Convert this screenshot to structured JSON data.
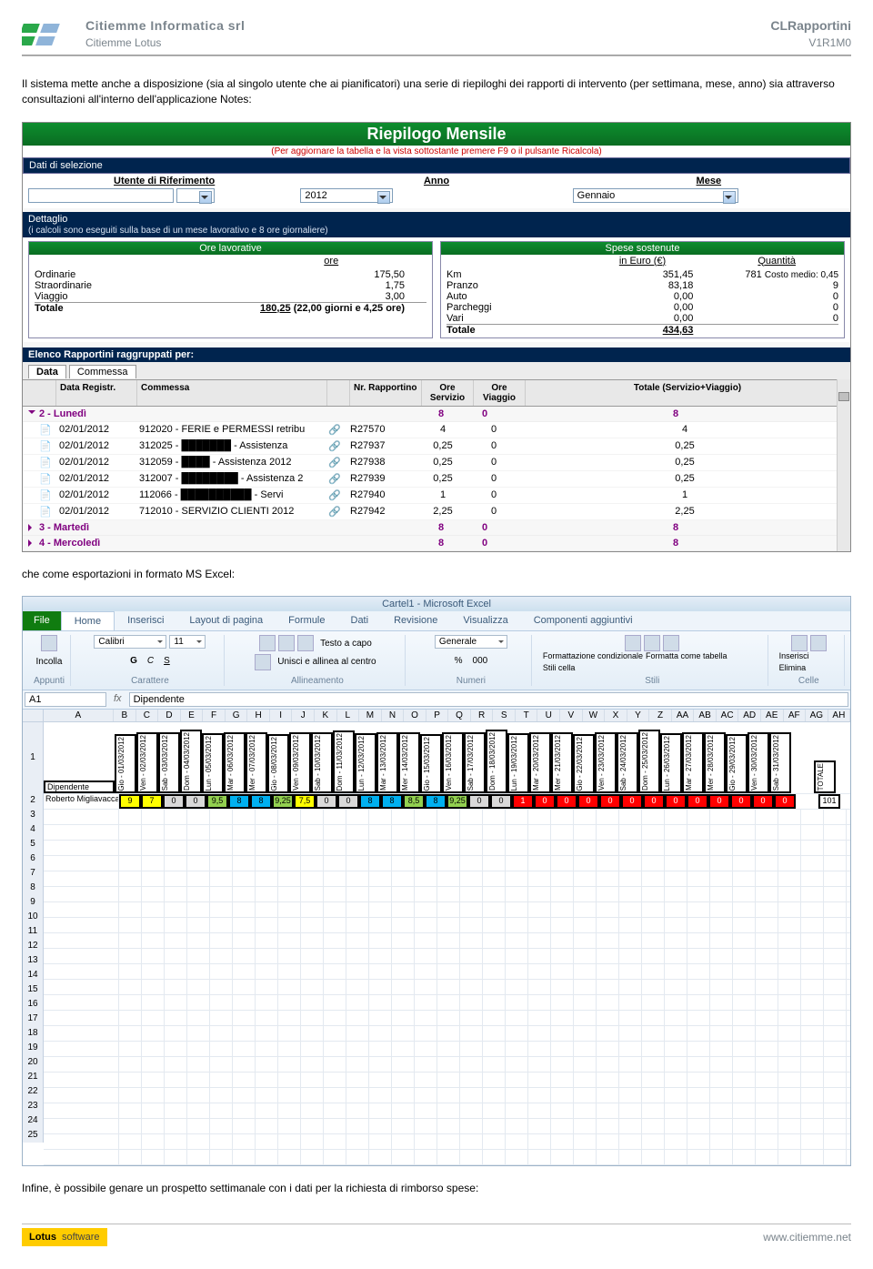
{
  "header": {
    "company": "Citiemme Informatica srl",
    "sub": "Citiemme Lotus",
    "product": "CLRapportini",
    "version": "V1R1M0"
  },
  "para1": "Il sistema mette anche a disposizione (sia al singolo utente che ai pianificatori) una serie di riepiloghi dei rapporti di intervento (per settimana, mese, anno) sia attraverso consultazioni all'interno dell'applicazione Notes:",
  "lotus": {
    "title": "Riepilogo Mensile",
    "hint": "(Per aggiornare la tabella e la vista sottostante premere F9 o il pulsante Ricalcola)",
    "sel": {
      "head": "Dati di selezione",
      "user_lbl": "Utente di Riferimento",
      "user_val": "",
      "anno_lbl": "Anno",
      "anno_val": "2012",
      "mese_lbl": "Mese",
      "mese_val": "Gennaio"
    },
    "det": {
      "head": "Dettaglio",
      "note": "(i calcoli sono eseguiti sulla base di un mese lavorativo e 8 ore giornaliere)"
    },
    "ore": {
      "head": "Ore lavorative",
      "col": "ore",
      "rows": [
        [
          "Ordinarie",
          "175,50"
        ],
        [
          "Straordinarie",
          "1,75"
        ],
        [
          "Viaggio",
          "3,00"
        ]
      ],
      "tot_lbl": "Totale",
      "tot_val": "180,25",
      "note": "(22,00 giorni e 4,25 ore)"
    },
    "spese": {
      "head": "Spese sostenute",
      "col1": "in Euro (€)",
      "col2": "Quantità",
      "rows": [
        [
          "Km",
          "351,45",
          "781"
        ],
        [
          "Pranzo",
          "83,18",
          "9"
        ],
        [
          "Auto",
          "0,00",
          "0"
        ],
        [
          "Parcheggi",
          "0,00",
          "0"
        ],
        [
          "Vari",
          "0,00",
          "0"
        ]
      ],
      "tot_lbl": "Totale",
      "tot_val": "434,63",
      "costo": "Costo medio: 0,45"
    },
    "elHead": "Elenco Rapportini raggruppati per:",
    "tabs": [
      "Data",
      "Commessa"
    ],
    "gcols": [
      "",
      "Data Registr.",
      "Commessa",
      "",
      "Nr. Rapportino",
      "Ore Servizio",
      "Ore Viaggio",
      "Totale (Servizio+Viaggio)"
    ],
    "days": [
      {
        "label": "2 - Lunedì",
        "sum": [
          "8",
          "0",
          "8"
        ],
        "open": true,
        "rows": [
          [
            "02/01/2012",
            "912020 - FERIE e PERMESSI retribu",
            "R27570",
            "4",
            "0",
            "4"
          ],
          [
            "02/01/2012",
            "312025 - ███████ - Assistenza",
            "R27937",
            "0,25",
            "0",
            "0,25"
          ],
          [
            "02/01/2012",
            "312059 - ████ - Assistenza 2012",
            "R27938",
            "0,25",
            "0",
            "0,25"
          ],
          [
            "02/01/2012",
            "312007 - ████████ - Assistenza 2",
            "R27939",
            "0,25",
            "0",
            "0,25"
          ],
          [
            "02/01/2012",
            "112066 - ██████████ - Servi",
            "R27940",
            "1",
            "0",
            "1"
          ],
          [
            "02/01/2012",
            "712010 - SERVIZIO CLIENTI 2012",
            "R27942",
            "2,25",
            "0",
            "2,25"
          ]
        ]
      },
      {
        "label": "3 - Martedì",
        "sum": [
          "8",
          "0",
          "8"
        ],
        "open": false
      },
      {
        "label": "4 - Mercoledì",
        "sum": [
          "8",
          "0",
          "8"
        ],
        "open": false
      }
    ]
  },
  "para2": "che come esportazioni in formato MS Excel:",
  "excel": {
    "winTitle": "Cartel1 - Microsoft Excel",
    "fileTab": "File",
    "tabs": [
      "Home",
      "Inserisci",
      "Layout di pagina",
      "Formule",
      "Dati",
      "Revisione",
      "Visualizza",
      "Componenti aggiuntivi"
    ],
    "groups": {
      "appunti": "Appunti",
      "carattere": "Carattere",
      "allinea": "Allineamento",
      "numeri": "Numeri",
      "stili": "Stili",
      "celle": "Celle"
    },
    "clip": "Incolla",
    "font": "Calibri",
    "size": "11",
    "wrap": "Testo a capo",
    "merge": "Unisci e allinea al centro",
    "numFmt": "Generale",
    "condFmt": "Formattazione condizionale",
    "asTable": "Formatta come tabella",
    "cellStyle": "Stili cella",
    "ins": "Inserisci",
    "del": "Elimina",
    "nameBox": "A1",
    "fxLabel": "fx",
    "fxVal": "Dipendente",
    "colLetters": [
      "A",
      "B",
      "C",
      "D",
      "E",
      "F",
      "G",
      "H",
      "I",
      "J",
      "K",
      "L",
      "M",
      "N",
      "O",
      "P",
      "Q",
      "R",
      "S",
      "T",
      "U",
      "V",
      "W",
      "X",
      "Y",
      "Z",
      "AA",
      "AB",
      "AC",
      "AD",
      "AE",
      "AF",
      "AG",
      "AH"
    ],
    "dateHeaders": [
      "Gio - 01/03/2012",
      "Ven - 02/03/2012",
      "Sab - 03/03/2012",
      "Dom - 04/03/2012",
      "Lun - 05/03/2012",
      "Mar - 06/03/2012",
      "Mer - 07/03/2012",
      "Gio - 08/03/2012",
      "Ven - 09/03/2012",
      "Sab - 10/03/2012",
      "Dom - 11/03/2012",
      "Lun - 12/03/2012",
      "Mar - 13/03/2012",
      "Mer - 14/03/2012",
      "Gio - 15/03/2012",
      "Ven - 16/03/2012",
      "Sab - 17/03/2012",
      "Dom - 18/03/2012",
      "Lun - 19/03/2012",
      "Mar - 20/03/2012",
      "Mer - 21/03/2012",
      "Gio - 22/03/2012",
      "Ven - 23/03/2012",
      "Sab - 24/03/2012",
      "Dom - 25/03/2012",
      "Lun - 26/03/2012",
      "Mar - 27/03/2012",
      "Mer - 28/03/2012",
      "Gio - 29/03/2012",
      "Ven - 30/03/2012",
      "Sab - 31/03/2012"
    ],
    "row1Label": "Dipendente",
    "totLabel": "TOTALE",
    "row2Name": "Roberto Migliavacca",
    "row2": [
      "9",
      "7",
      "0",
      "0",
      "9,5",
      "8",
      "8",
      "9,25",
      "7,5",
      "0",
      "0",
      "8",
      "8",
      "8,5",
      "8",
      "9,25",
      "0",
      "0",
      "1",
      "0",
      "0",
      "0",
      "0",
      "0",
      "0",
      "0",
      "0",
      "0",
      "0",
      "0",
      "0"
    ],
    "row2Colors": [
      "Y",
      "Y",
      "Gr",
      "Gr",
      "G",
      "C",
      "C",
      "G",
      "Y",
      "Gr",
      "Gr",
      "C",
      "C",
      "G",
      "C",
      "G",
      "Gr",
      "Gr",
      "R",
      "R",
      "R",
      "R",
      "R",
      "R",
      "R",
      "R",
      "R",
      "R",
      "R",
      "R",
      "R"
    ],
    "row2Tot": "101"
  },
  "para3": "Infine, è possibile genare un prospetto settimanale con i dati per la richiesta di rimborso spese:",
  "footer": {
    "lotus": "Lotus",
    "soft": "software",
    "url": "www.citiemme.net"
  }
}
